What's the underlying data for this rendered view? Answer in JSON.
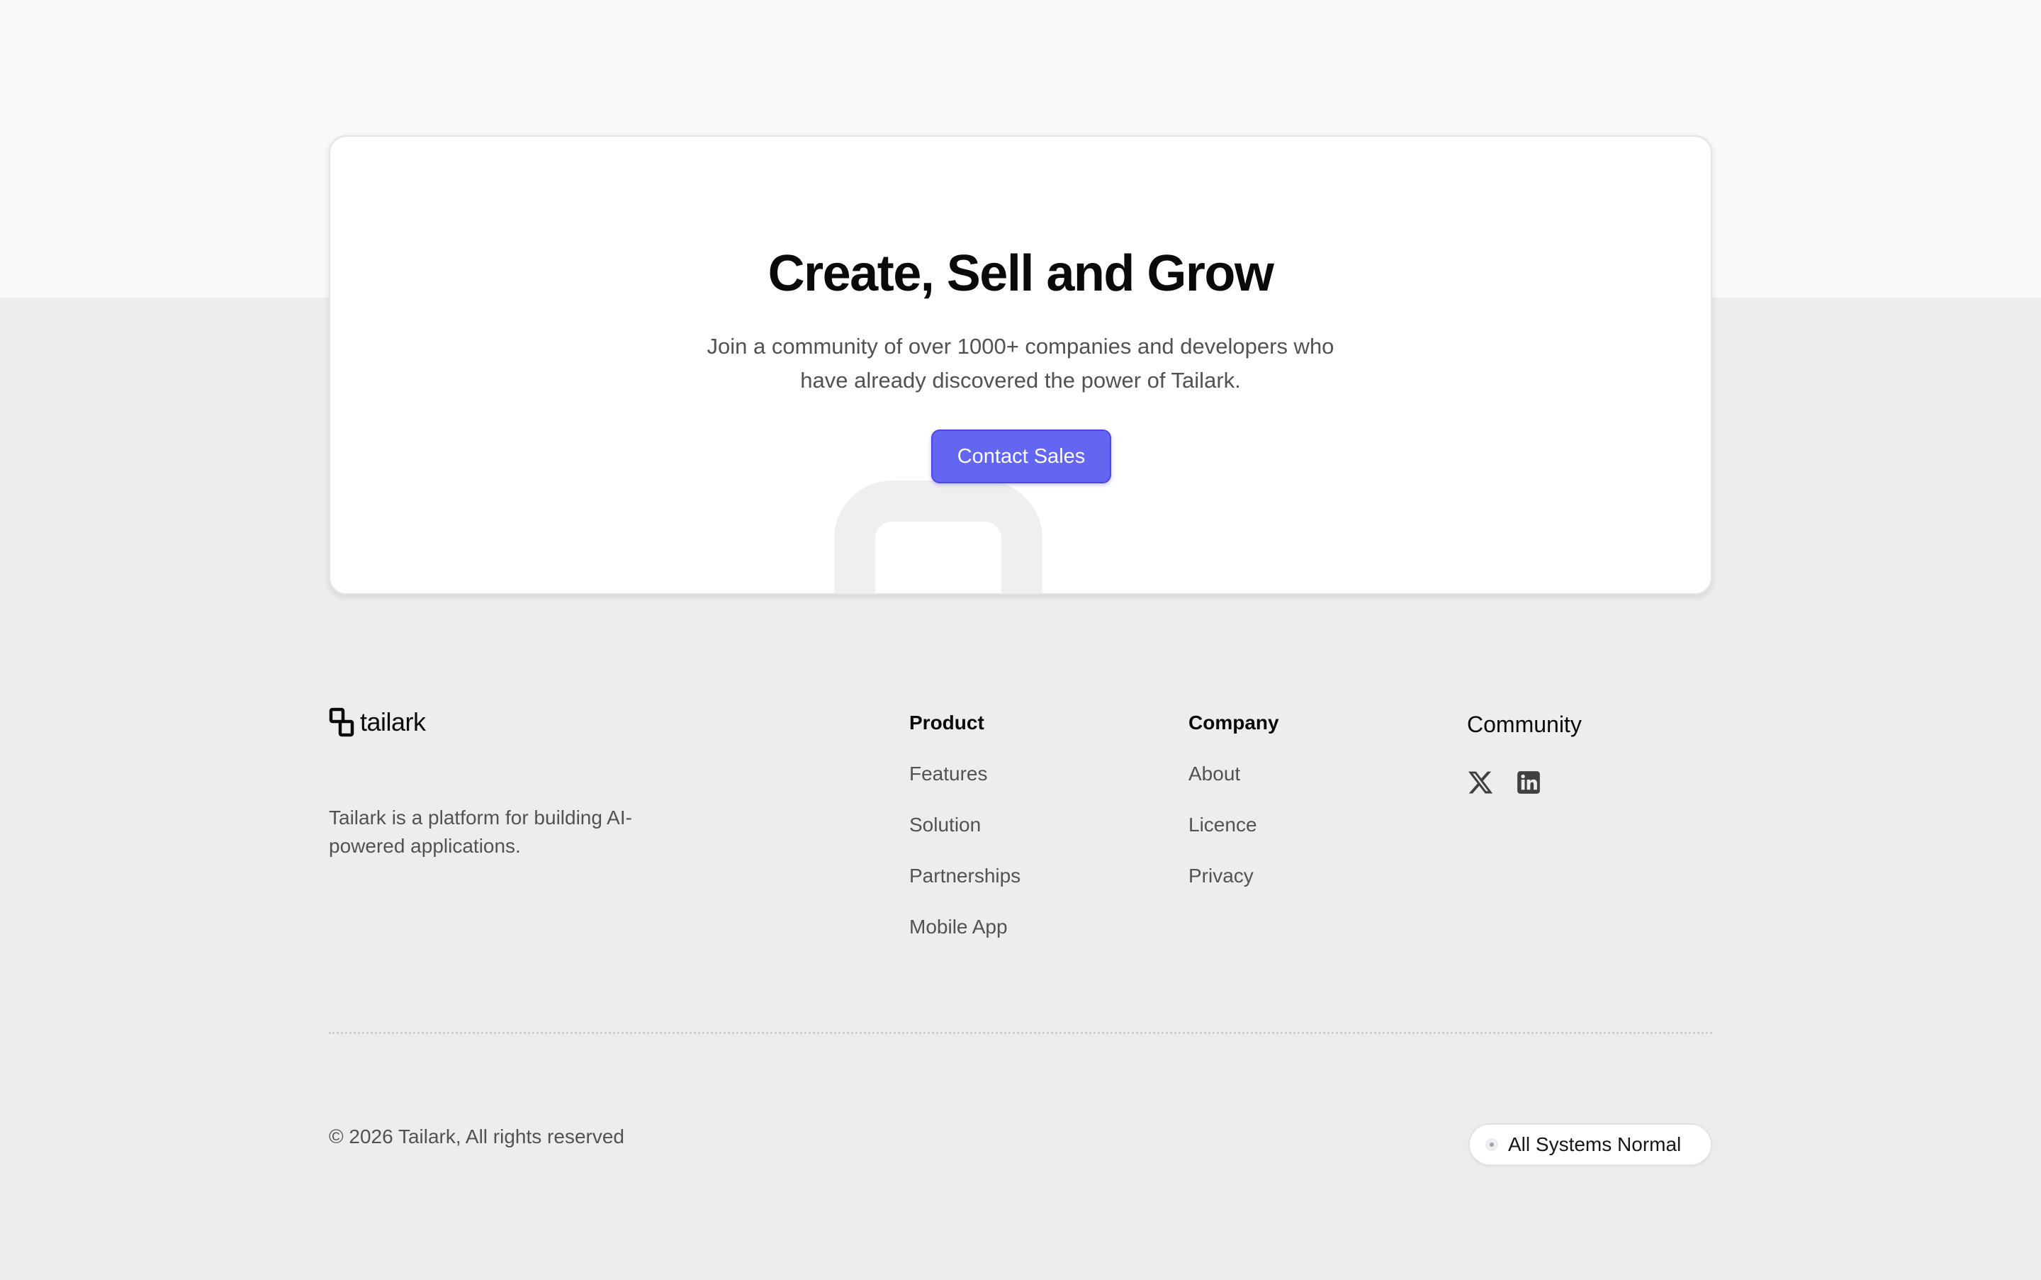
{
  "cta": {
    "title": "Create, Sell and Grow",
    "description": "Join a community of over 1000+ companies and developers who have already discovered the power of Tailark.",
    "button_label": "Contact Sales",
    "accent_color": "#6366f1"
  },
  "footer": {
    "brand": {
      "name": "tailark",
      "logo_icon": "tailark-logo-icon",
      "tagline": "Tailark is a platform for building AI-powered applications."
    },
    "columns": [
      {
        "title": "Product",
        "links": [
          "Features",
          "Solution",
          "Partnerships",
          "Mobile App"
        ]
      },
      {
        "title": "Company",
        "links": [
          "About",
          "Licence",
          "Privacy"
        ]
      }
    ],
    "community": {
      "title": "Community",
      "social": [
        {
          "icon": "x-icon",
          "label": "X"
        },
        {
          "icon": "linkedin-icon",
          "label": "LinkedIn"
        }
      ]
    },
    "copyright": "© 2026 Tailark, All rights reserved",
    "status": {
      "label": "All Systems Normal"
    }
  }
}
